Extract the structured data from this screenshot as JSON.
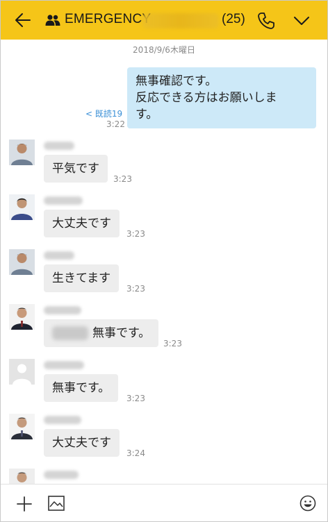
{
  "header": {
    "title": "EMERGENCY",
    "member_count": "(25)",
    "icons": [
      "back-arrow-icon",
      "group-icon",
      "phone-icon",
      "chevron-down-icon"
    ],
    "background": "#f5c518"
  },
  "chat": {
    "date": "2018/9/6木曜日",
    "outgoing": {
      "lines": [
        "無事確認です。",
        "反応できる方はお願いしま",
        "す。"
      ],
      "read": "< 既読19",
      "time": "3:22",
      "bubble_color": "#cde9f8"
    },
    "incoming": [
      {
        "text": "平気です",
        "time": "3:23"
      },
      {
        "text": "大丈夫です",
        "time": "3:23"
      },
      {
        "text": "生きてます",
        "time": "3:23"
      },
      {
        "text": "無事です。",
        "time": "3:23"
      },
      {
        "text": "無事です。",
        "time": "3:23"
      },
      {
        "text": "大丈夫です",
        "time": "3:24"
      }
    ]
  },
  "bottom_bar": {
    "icons": [
      "plus-icon",
      "image-icon",
      "emoji-icon"
    ]
  }
}
